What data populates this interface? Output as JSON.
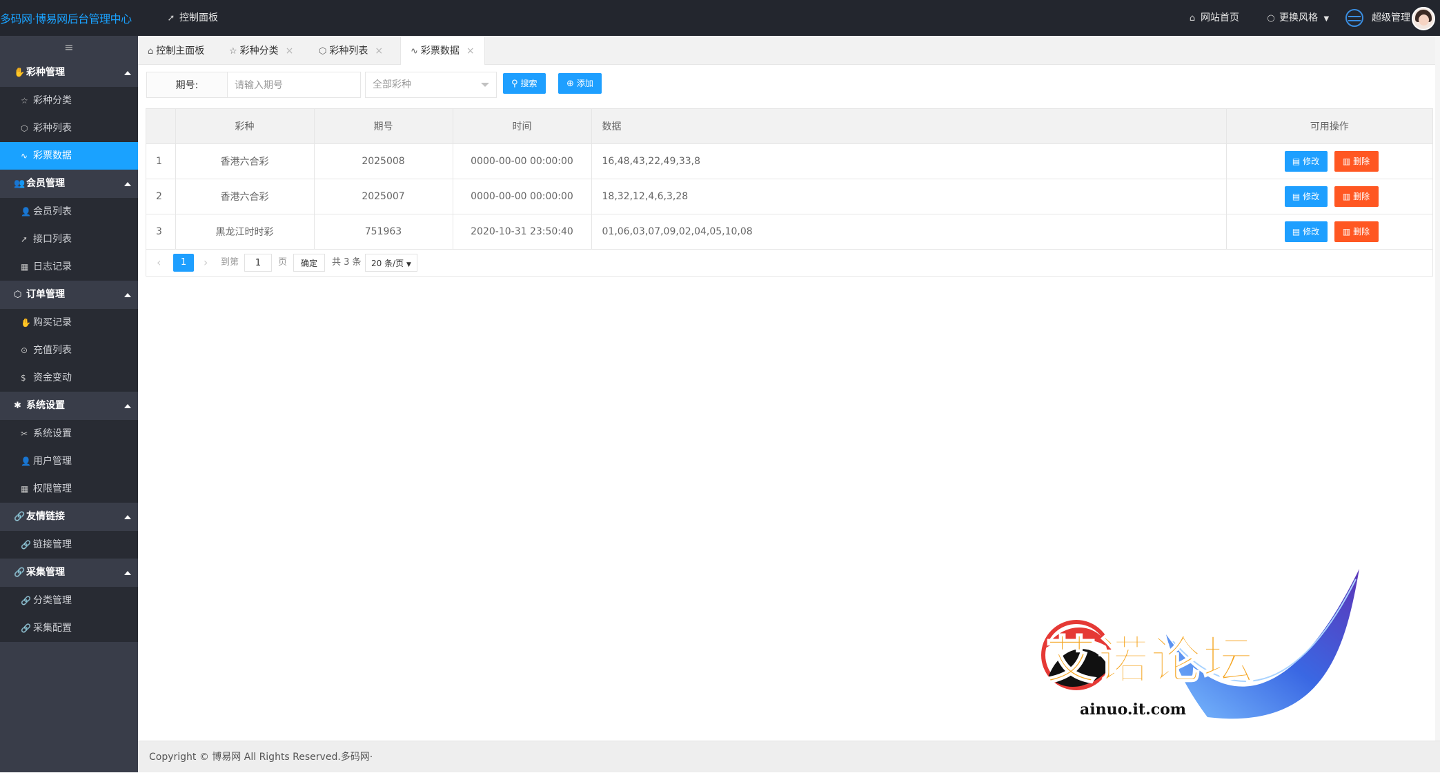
{
  "header": {
    "logo": "多码网·博易网后台管理中心",
    "dashboard_link": "控制面板",
    "home_link": "网站首页",
    "theme_link": "更换风格",
    "user": "超级管理"
  },
  "sidebar": {
    "toggle": "≡",
    "groups": [
      {
        "label": "彩种管理",
        "items": [
          "彩种分类",
          "彩种列表",
          "彩票数据"
        ]
      },
      {
        "label": "会员管理",
        "items": [
          "会员列表",
          "接口列表",
          "日志记录"
        ]
      },
      {
        "label": "订单管理",
        "items": [
          "购买记录",
          "充值列表",
          "资金变动"
        ]
      },
      {
        "label": "系统设置",
        "items": [
          "系统设置",
          "用户管理",
          "权限管理"
        ]
      },
      {
        "label": "友情链接",
        "items": [
          "链接管理"
        ]
      },
      {
        "label": "采集管理",
        "items": [
          "分类管理",
          "采集配置"
        ]
      }
    ],
    "active_item": "彩票数据"
  },
  "tabs": [
    {
      "label": "控制主面板"
    },
    {
      "label": "彩种分类"
    },
    {
      "label": "彩种列表"
    },
    {
      "label": "彩票数据"
    }
  ],
  "search": {
    "label": "期号:",
    "placeholder": "请输入期号",
    "select_value": "全部彩种",
    "search_button": "搜索",
    "add_button": "添加"
  },
  "table": {
    "columns": [
      "",
      "彩种",
      "期号",
      "时间",
      "数据",
      "可用操作"
    ],
    "rows": [
      {
        "no": "1",
        "lottery": "香港六合彩",
        "issue": "2025008",
        "time": "0000-00-00 00:00:00",
        "data": "16,48,43,22,49,33,8"
      },
      {
        "no": "2",
        "lottery": "香港六合彩",
        "issue": "2025007",
        "time": "0000-00-00 00:00:00",
        "data": "18,32,12,4,6,3,28"
      },
      {
        "no": "3",
        "lottery": "黑龙江时时彩",
        "issue": "751963",
        "time": "2020-10-31 23:50:40",
        "data": "01,06,03,07,09,02,04,05,10,08"
      }
    ],
    "edit_label": "修改",
    "delete_label": "删除"
  },
  "pager": {
    "current": "1",
    "goto_label": "到第",
    "goto_value": "1",
    "page_label": "页",
    "confirm": "确定",
    "total": "共 3 条",
    "page_size": "20 条/页"
  },
  "footer": {
    "copyright": "Copyright © 博易网 All Rights Reserved.多码网·"
  },
  "watermark": {
    "text": "艾诺论坛",
    "url": "ainuo.it.com"
  },
  "colors": {
    "header_bg": "#23262e",
    "sidebar_bg": "#393d49",
    "accent": "#1aa2ff",
    "danger": "#ff5722"
  }
}
